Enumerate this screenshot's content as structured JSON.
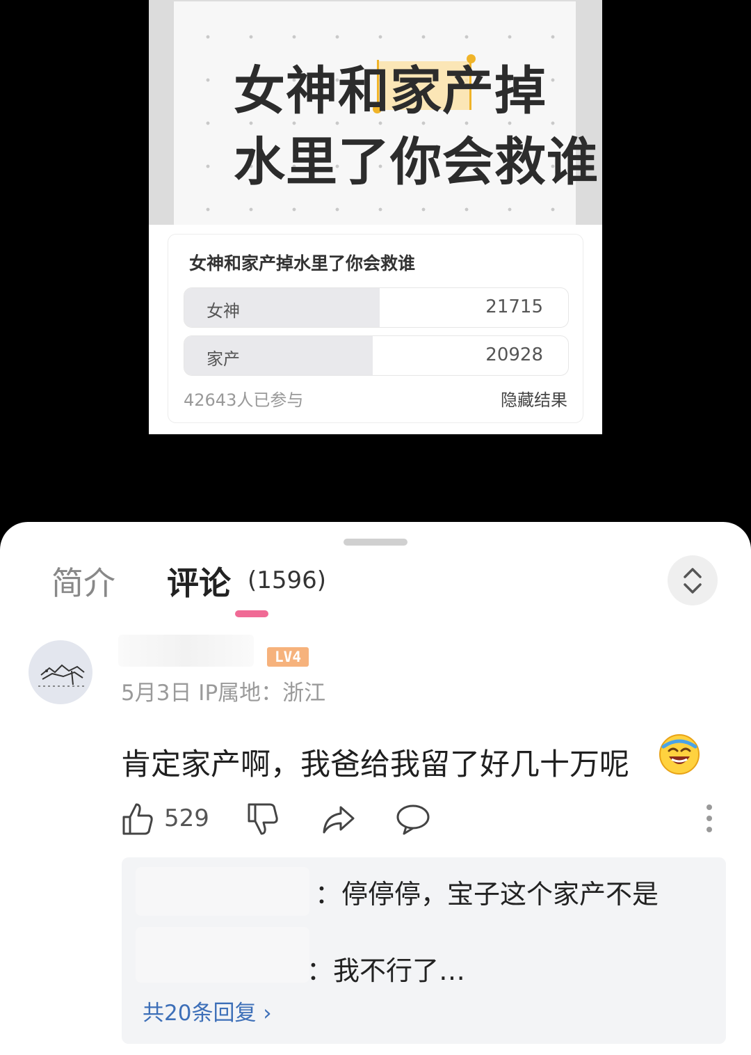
{
  "cover": {
    "line1": "女神和家产掉",
    "line2": "水里了你会救谁"
  },
  "poll": {
    "question": "女神和家产掉水里了你会救谁",
    "options": [
      {
        "label": "女神",
        "count": "21715",
        "share": 0.509
      },
      {
        "label": "家产",
        "count": "20928",
        "share": 0.491
      }
    ],
    "participants": "42643人已参与",
    "hide_results": "隐藏结果"
  },
  "tabs": {
    "intro": "简介",
    "comments": "评论",
    "comment_count": "(1596)"
  },
  "comment": {
    "level": "LV4",
    "meta": "5月3日 IP属地：浙江",
    "text": "肯定家产啊，我爸给我留了好几十万呢",
    "emoji": "laughing-crying-emoji",
    "likes": "529"
  },
  "replies": {
    "reply1": "：停停停，宝子这个家产不是",
    "reply2": "：我不行了…",
    "more": "共20条回复 ›"
  },
  "colors": {
    "accent_pink": "#f06a95",
    "level_badge": "#f6b27c",
    "link_blue": "#3d6fb8",
    "highlight": "#f0b429"
  }
}
